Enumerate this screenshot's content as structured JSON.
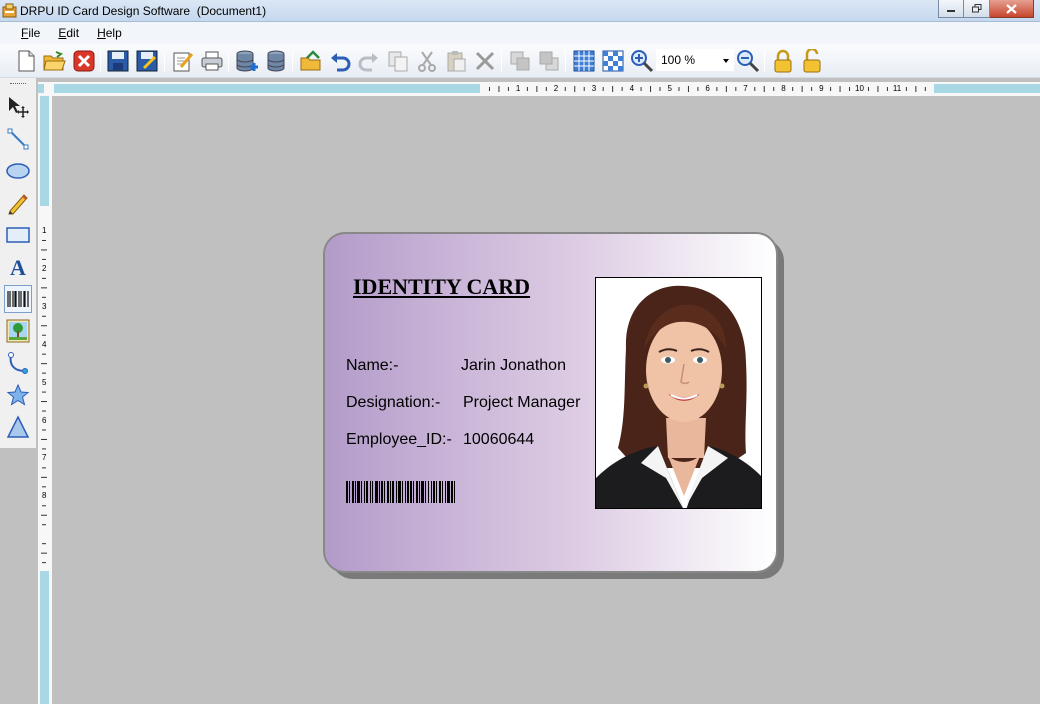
{
  "window": {
    "title": "DRPU ID Card Design Software  (Document1)",
    "app_icon": "app-icon",
    "controls": [
      "minimize-icon",
      "restore-icon",
      "close-icon"
    ]
  },
  "menu": {
    "items": [
      {
        "label": "File",
        "mnemonic": "F"
      },
      {
        "label": "Edit",
        "mnemonic": "E"
      },
      {
        "label": "Help",
        "mnemonic": "H"
      }
    ]
  },
  "toolbar": {
    "icons": [
      "new-document-icon",
      "open-folder-icon",
      "close-document-icon",
      "save-icon",
      "save-as-icon",
      "edit-icon",
      "print-icon",
      "database-add-icon",
      "database-icon",
      "export-icon",
      "undo-icon",
      "redo-icon",
      "copy-icon",
      "cut-icon",
      "paste-icon",
      "delete-icon",
      "bring-front-icon",
      "send-back-icon",
      "grid-icon",
      "transparent-grid-icon",
      "zoom-in-icon",
      "zoom-out-icon",
      "lock-icon",
      "unlock-icon"
    ],
    "zoom_value": "100 %"
  },
  "tools": [
    "pointer-move-icon",
    "line-icon",
    "ellipse-icon",
    "pencil-icon",
    "rectangle-icon",
    "text-icon",
    "barcode-icon",
    "image-icon",
    "arc-icon",
    "star-icon",
    "triangle-icon"
  ],
  "rulers": {
    "horizontal_labels": [
      "1",
      "2",
      "3",
      "4",
      "5",
      "6",
      "7",
      "8",
      "9",
      "10",
      "11"
    ],
    "vertical_labels": [
      "1",
      "2",
      "3",
      "4",
      "5",
      "6",
      "7",
      "8"
    ]
  },
  "card": {
    "title": "IDENTITY CARD",
    "name_label": "Name:-",
    "name_value": "Jarin Jonathon",
    "designation_label": "Designation:-",
    "designation_value": "Project Manager",
    "employee_id_label": "Employee_ID:-",
    "employee_id_value": "10060644",
    "colors": {
      "gradient_start": "#b39bc9",
      "gradient_end": "#ffffff",
      "border": "#888888"
    }
  }
}
